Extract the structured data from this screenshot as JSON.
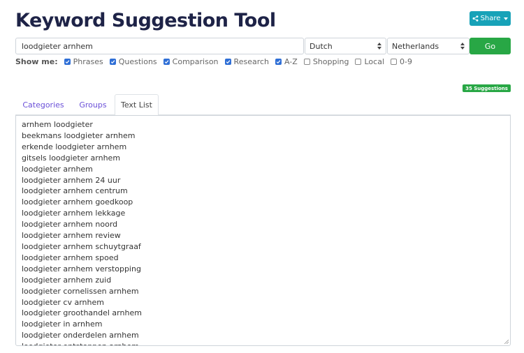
{
  "title": "Keyword Suggestion Tool",
  "share": {
    "label": "Share",
    "icon": "share-icon"
  },
  "search": {
    "value": "loodgieter arnhem",
    "placeholder": ""
  },
  "language": {
    "selected": "Dutch"
  },
  "country": {
    "selected": "Netherlands"
  },
  "go": {
    "label": "Go"
  },
  "show_me": {
    "label": "Show me:",
    "options": [
      {
        "label": "Phrases",
        "checked": true
      },
      {
        "label": "Questions",
        "checked": true
      },
      {
        "label": "Comparison",
        "checked": true
      },
      {
        "label": "Research",
        "checked": true
      },
      {
        "label": "A-Z",
        "checked": true
      },
      {
        "label": "Shopping",
        "checked": false
      },
      {
        "label": "Local",
        "checked": false
      },
      {
        "label": "0-9",
        "checked": false
      }
    ]
  },
  "suggestions_badge": "35 Suggestions",
  "tabs": [
    {
      "label": "Categories",
      "active": false
    },
    {
      "label": "Groups",
      "active": false
    },
    {
      "label": "Text List",
      "active": true
    }
  ],
  "text_list": [
    "arnhem loodgieter",
    "beekmans loodgieter arnhem",
    "erkende loodgieter arnhem",
    "gitsels loodgieter arnhem",
    "loodgieter arnhem",
    "loodgieter arnhem 24 uur",
    "loodgieter arnhem centrum",
    "loodgieter arnhem goedkoop",
    "loodgieter arnhem lekkage",
    "loodgieter arnhem noord",
    "loodgieter arnhem review",
    "loodgieter arnhem schuytgraaf",
    "loodgieter arnhem spoed",
    "loodgieter arnhem verstopping",
    "loodgieter arnhem zuid",
    "loodgieter cornelissen arnhem",
    "loodgieter cv arnhem",
    "loodgieter groothandel arnhem",
    "loodgieter in arnhem",
    "loodgieter onderdelen arnhem",
    "loodgieter ontstoppen arnhem"
  ],
  "colors": {
    "title": "#1e2347",
    "share": "#17a2b8",
    "go": "#28a745",
    "badge": "#28a745",
    "checkbox": "#2f6fd6",
    "tab_link": "#6a4fd8"
  }
}
